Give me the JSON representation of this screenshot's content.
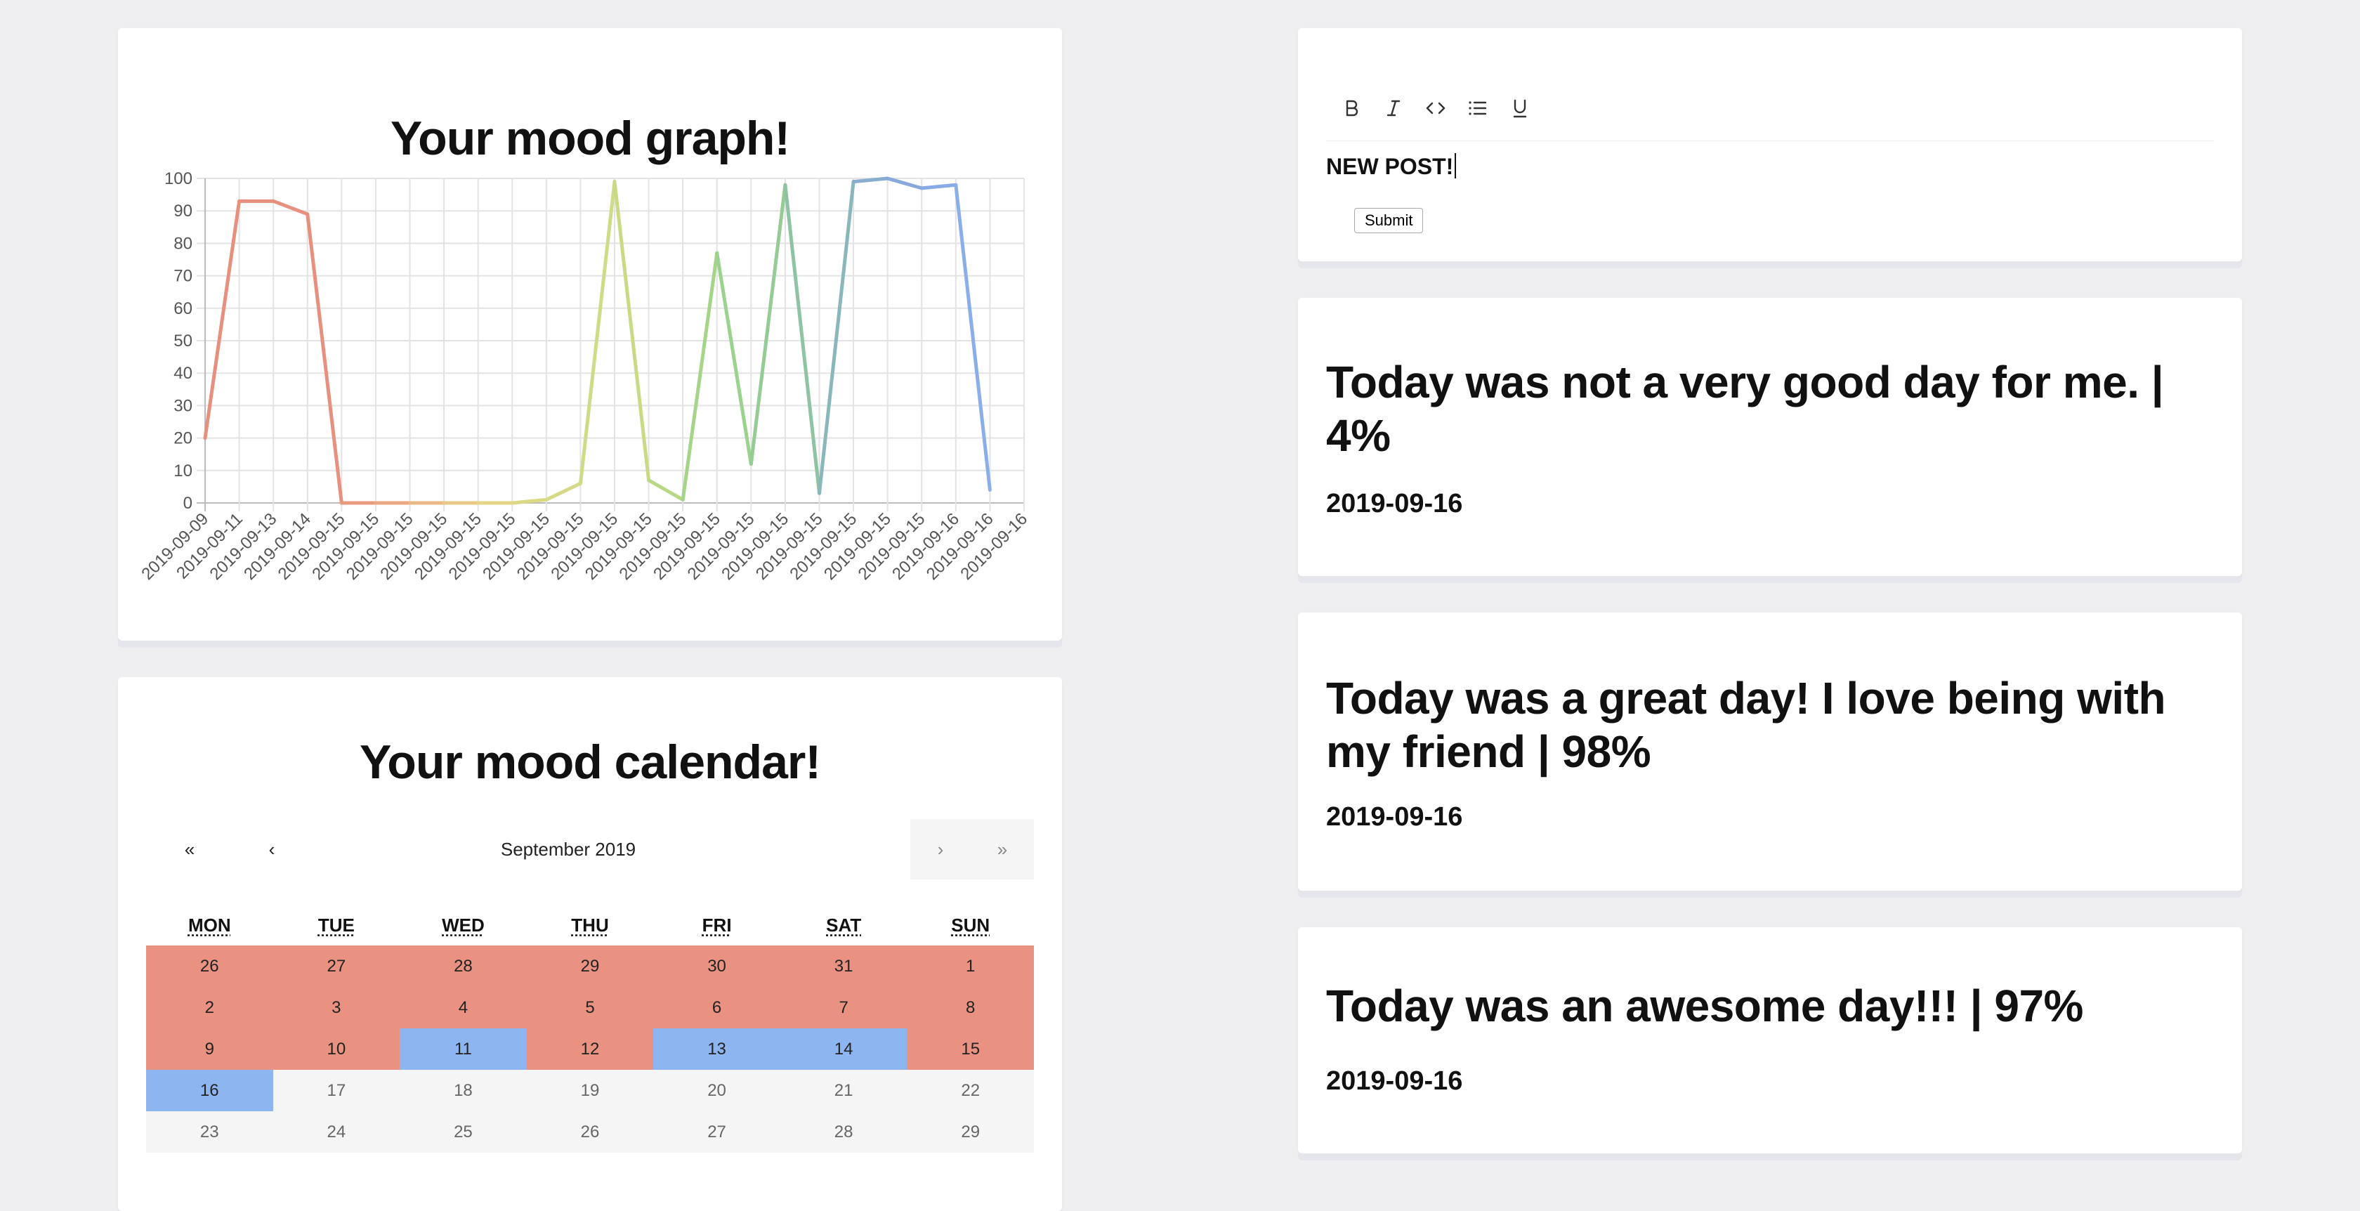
{
  "graph": {
    "title": "Your mood graph!"
  },
  "chart_data": {
    "type": "line",
    "title": "Your mood graph!",
    "xlabel": "",
    "ylabel": "",
    "ylim": [
      0,
      100
    ],
    "yticks": [
      0,
      10,
      20,
      30,
      40,
      50,
      60,
      70,
      80,
      90,
      100
    ],
    "grid": true,
    "legend": "none",
    "categories": [
      "2019-09-09",
      "2019-09-11",
      "2019-09-13",
      "2019-09-14",
      "2019-09-15",
      "2019-09-15",
      "2019-09-15",
      "2019-09-15",
      "2019-09-15",
      "2019-09-15",
      "2019-09-15",
      "2019-09-15",
      "2019-09-15",
      "2019-09-15",
      "2019-09-15",
      "2019-09-15",
      "2019-09-15",
      "2019-09-15",
      "2019-09-15",
      "2019-09-15",
      "2019-09-15",
      "2019-09-15",
      "2019-09-16",
      "2019-09-16",
      "2019-09-16"
    ],
    "values": [
      20,
      93,
      93,
      89,
      0,
      0,
      0,
      0,
      0,
      0,
      1,
      6,
      99,
      7,
      1,
      77,
      12,
      98,
      3,
      99,
      100,
      97,
      98,
      4
    ],
    "colors": [
      "#e8907e",
      "#e8907e",
      "#e8907e",
      "#e8907e",
      "#e89a80",
      "#e9a882",
      "#e9b884",
      "#e8c886",
      "#e4d486",
      "#dcd984",
      "#d6d985",
      "#cfdb86",
      "#c8db84",
      "#b8d884",
      "#a6d58a",
      "#9bd28e",
      "#95cc95",
      "#8ec4a4",
      "#8ab7bb",
      "#89adcf",
      "#89a8db",
      "#88aae6",
      "#89aeea",
      "#89b2ee"
    ]
  },
  "calendar": {
    "title": "Your mood calendar!",
    "nav_prev2": "«",
    "nav_prev": "‹",
    "month_label": "September 2019",
    "nav_next": "›",
    "nav_next2": "»",
    "weekdays": [
      "MON",
      "TUE",
      "WED",
      "THU",
      "FRI",
      "SAT",
      "SUN"
    ],
    "days": [
      {
        "label": "26",
        "mood": "red"
      },
      {
        "label": "27",
        "mood": "red"
      },
      {
        "label": "28",
        "mood": "red"
      },
      {
        "label": "29",
        "mood": "red"
      },
      {
        "label": "30",
        "mood": "red"
      },
      {
        "label": "31",
        "mood": "red"
      },
      {
        "label": "1",
        "mood": "red"
      },
      {
        "label": "2",
        "mood": "red"
      },
      {
        "label": "3",
        "mood": "red"
      },
      {
        "label": "4",
        "mood": "red"
      },
      {
        "label": "5",
        "mood": "red"
      },
      {
        "label": "6",
        "mood": "red"
      },
      {
        "label": "7",
        "mood": "red"
      },
      {
        "label": "8",
        "mood": "red"
      },
      {
        "label": "9",
        "mood": "red"
      },
      {
        "label": "10",
        "mood": "red"
      },
      {
        "label": "11",
        "mood": "blue"
      },
      {
        "label": "12",
        "mood": "red"
      },
      {
        "label": "13",
        "mood": "blue"
      },
      {
        "label": "14",
        "mood": "blue"
      },
      {
        "label": "15",
        "mood": "red"
      },
      {
        "label": "16",
        "mood": "blue"
      },
      {
        "label": "17",
        "mood": "plain"
      },
      {
        "label": "18",
        "mood": "plain"
      },
      {
        "label": "19",
        "mood": "plain"
      },
      {
        "label": "20",
        "mood": "plain"
      },
      {
        "label": "21",
        "mood": "plain"
      },
      {
        "label": "22",
        "mood": "plain"
      },
      {
        "label": "23",
        "mood": "plain"
      },
      {
        "label": "24",
        "mood": "plain"
      },
      {
        "label": "25",
        "mood": "plain"
      },
      {
        "label": "26",
        "mood": "plain"
      },
      {
        "label": "27",
        "mood": "plain"
      },
      {
        "label": "28",
        "mood": "plain"
      },
      {
        "label": "29",
        "mood": "plain"
      }
    ]
  },
  "editor": {
    "tools": [
      "bold-icon",
      "italic-icon",
      "code-icon",
      "list-icon",
      "underline-icon"
    ],
    "text": "NEW POST!",
    "submit_label": "Submit"
  },
  "posts": [
    {
      "title": "Today was not a very good day for me. | 4%",
      "date": "2019-09-16"
    },
    {
      "title": "Today was a great day! I love being with my friend | 98%",
      "date": "2019-09-16"
    },
    {
      "title": "Today was an awesome day!!! | 97%",
      "date": "2019-09-16"
    }
  ],
  "colors": {
    "page_bg": "#efeff1",
    "bad_day": "#e99282",
    "good_day": "#8db5ef"
  }
}
